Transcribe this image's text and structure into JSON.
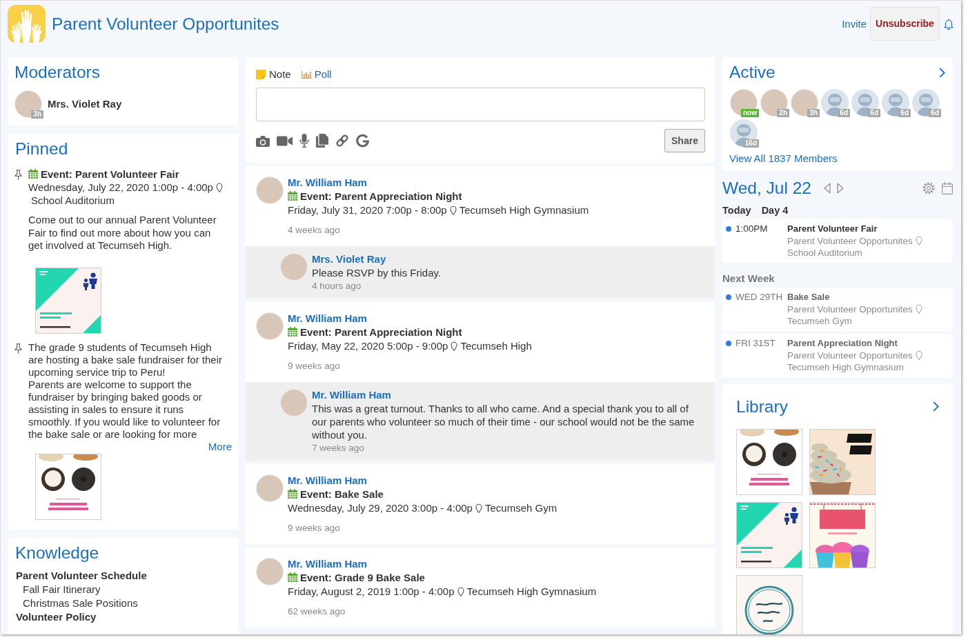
{
  "header": {
    "title": "Parent Volunteer Opportunites",
    "actions": [
      {
        "label": "Invite",
        "kind": "link"
      },
      {
        "label": "Unsubscribe",
        "kind": "button"
      }
    ]
  },
  "moderators": {
    "title": "Moderators",
    "members": [
      {
        "name": "Mrs. Violet Ray",
        "badge": "3h"
      }
    ]
  },
  "pinned": {
    "title": "Pinned",
    "items": [
      {
        "kind": "event",
        "title": "Event: Parent Volunteer Fair",
        "when": "Wednesday, July 22, 2020 1:00p - 4:00p",
        "location": "School Auditorium",
        "paragraphs": [
          "Come out to our annual Parent Volunteer Fair to find out more about how you can get involved at Tecumseh High."
        ],
        "image": {
          "kind": "fair"
        }
      },
      {
        "kind": "note",
        "paragraphs": [
          "The grade 9 students of Tecumseh High are hosting a bake sale fundraiser for their upcoming service trip to Peru!",
          "Parents are welcome to support the fundraiser by bringing baked goods or assisting in sales to ensure it runs smoothly. If you would like to volunteer for the bake sale or are looking for more"
        ],
        "more": "More",
        "image": {
          "kind": "donuts"
        }
      }
    ]
  },
  "knowledge": {
    "title": "Knowledge",
    "items": [
      {
        "label": "Parent Volunteer Schedule",
        "children": [
          {
            "label": "Fall Fair Itinerary"
          },
          {
            "label": "Christmas Sale Positions"
          }
        ]
      },
      {
        "label": "Volunteer Policy"
      }
    ]
  },
  "composer": {
    "tabs": [
      {
        "label": "Note",
        "kind": "note",
        "selected": true
      },
      {
        "label": "Poll",
        "kind": "poll",
        "selected": false
      }
    ],
    "share": "Share"
  },
  "feed": [
    {
      "author": "Mr. William Ham",
      "title": "Event: Parent Appreciation Night",
      "when": "Friday, July 31, 2020 7:00p - 8:00p",
      "location": "Tecumseh High Gymnasium",
      "time": "4 weeks ago",
      "replies": [
        {
          "author": "Mrs. Violet Ray",
          "text": "Please RSVP by this Friday.",
          "time": "4 hours ago"
        }
      ]
    },
    {
      "author": "Mr. William Ham",
      "title": "Event: Parent Appreciation Night",
      "when": "Friday, May 22, 2020 5:00p - 9:00p",
      "location": "Tecumseh High",
      "time": "9 weeks ago",
      "replies": [
        {
          "author": "Mr. William Ham",
          "text": "This was a great turnout. Thanks to all who came. And a special thank you to all of our parents who volunteer so much of their time - our school would not be the same without you.",
          "time": "7 weeks ago"
        }
      ]
    },
    {
      "author": "Mr. William Ham",
      "title": "Event: Bake Sale",
      "when": "Wednesday, July 29, 2020 3:00p - 4:00p",
      "location": "Tecumseh Gym",
      "time": "9 weeks ago"
    },
    {
      "author": "Mr. William Ham",
      "title": "Event: Grade 9 Bake Sale",
      "when": "Friday, August 2, 2019 1:00p - 4:00p",
      "location": "Tecumseh High Gymnasium",
      "time": "62 weeks ago"
    }
  ],
  "active": {
    "title": "Active",
    "members": [
      {
        "kind": "photo",
        "badge": "now",
        "color": "#5cb531"
      },
      {
        "kind": "photo",
        "badge": "2h",
        "color": "#a8a8a8"
      },
      {
        "kind": "photo",
        "badge": "3h",
        "color": "#a8a8a8"
      },
      {
        "kind": "default",
        "badge": "6d",
        "color": "#a8a8a8"
      },
      {
        "kind": "default",
        "badge": "6d",
        "color": "#a8a8a8"
      },
      {
        "kind": "default",
        "badge": "6d",
        "color": "#a8a8a8"
      },
      {
        "kind": "default",
        "badge": "6d",
        "color": "#a8a8a8"
      },
      {
        "kind": "default",
        "badge": "16d",
        "color": "#a8a8a8"
      }
    ],
    "view_all": "View All 1837 Members"
  },
  "calendar": {
    "date": "Wed, Jul 22",
    "today_label": "Today",
    "day_label": "Day 4",
    "today_events": [
      {
        "time": "1:00PM",
        "title": "Parent Volunteer Fair",
        "group": "Parent Volunteer Opportunites",
        "location": "School Auditorium",
        "color": "#2f7de1"
      }
    ],
    "next_week": {
      "heading": "Next Week",
      "events": [
        {
          "time": "WED 29TH",
          "title": "Bake Sale",
          "group": "Parent Volunteer Opportunites",
          "location": "Tecumseh Gym",
          "color": "#2f7de1"
        },
        {
          "time": "FRI 31ST",
          "title": "Parent Appreciation Night",
          "group": "Parent Volunteer Opportunites",
          "location": "Tecumseh High Gymnasium",
          "color": "#2f7de1"
        }
      ]
    }
  },
  "library": {
    "title": "Library",
    "items": [
      {
        "kind": "donuts"
      },
      {
        "kind": "cupcake"
      },
      {
        "kind": "fair"
      },
      {
        "kind": "banner"
      },
      {
        "kind": "store"
      }
    ]
  }
}
